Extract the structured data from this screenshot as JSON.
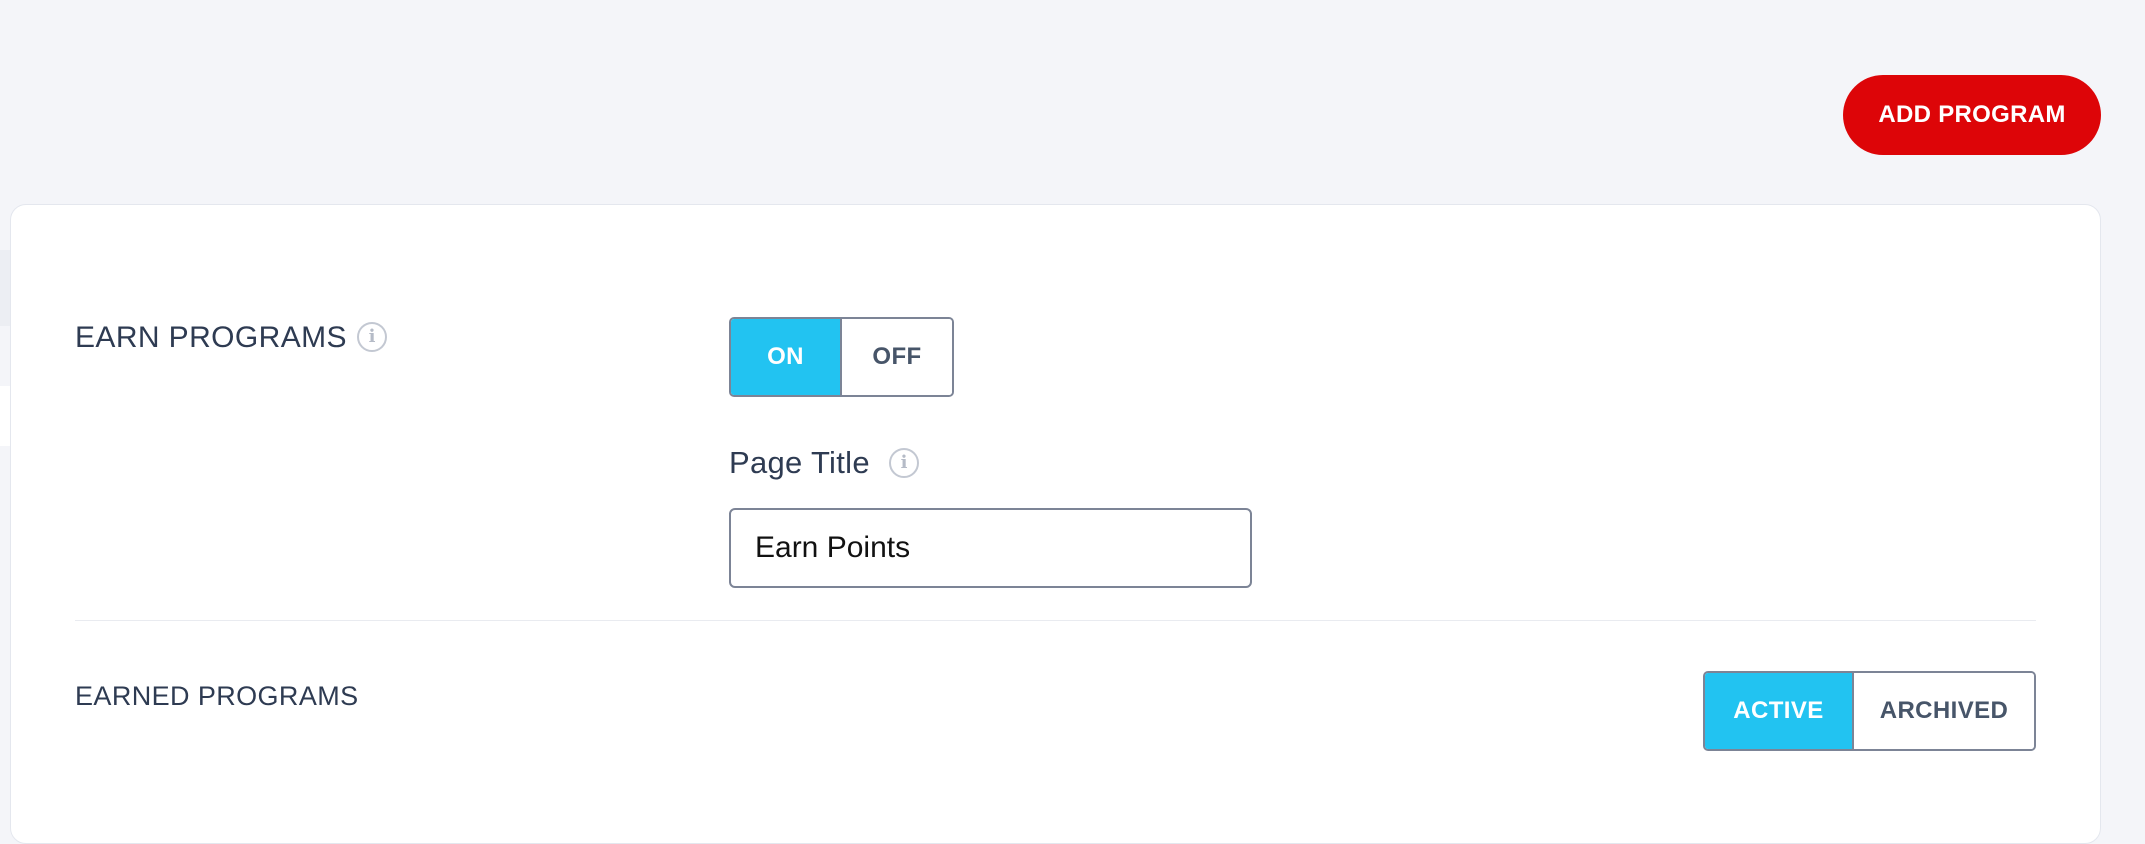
{
  "header": {
    "add_program_label": "ADD PROGRAM"
  },
  "earn_programs": {
    "label": "EARN PROGRAMS",
    "info_icon": "info-icon",
    "toggle": {
      "on_label": "ON",
      "off_label": "OFF",
      "selected": "ON"
    },
    "page_title": {
      "label": "Page Title",
      "info_icon": "info-icon",
      "value": "Earn Points"
    }
  },
  "earned_programs": {
    "label": "EARNED PROGRAMS",
    "filter": {
      "active_label": "ACTIVE",
      "archived_label": "ARCHIVED",
      "selected": "ACTIVE"
    }
  },
  "colors": {
    "accent": "#22c3f1",
    "primary_button": "#dd0508",
    "background": "#f4f5f9",
    "text": "#2e3b52"
  }
}
